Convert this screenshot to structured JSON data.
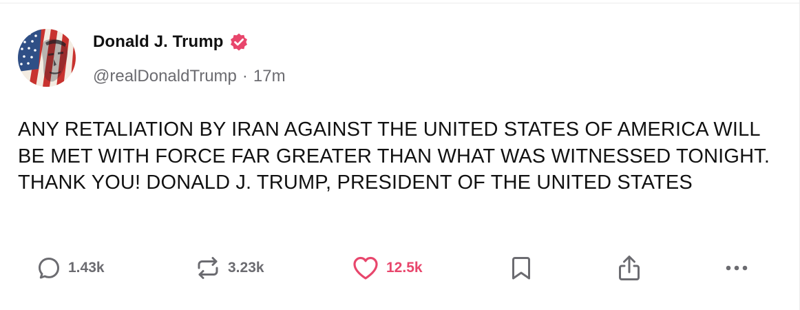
{
  "post": {
    "author": {
      "display_name": "Donald J. Trump",
      "handle": "@realDonaldTrump",
      "verified": true,
      "avatar_icon": "flag-portrait-avatar"
    },
    "separator": "·",
    "time_ago": "17m",
    "text": "ANY RETALIATION BY IRAN AGAINST THE UNITED STATES OF AMERICA WILL BE MET WITH FORCE FAR GREATER THAN WHAT WAS WITNESSED TONIGHT. THANK YOU! DONALD J. TRUMP, PRESIDENT OF THE UNITED STATES"
  },
  "actions": {
    "replies": {
      "icon": "reply-bubble-icon",
      "count": "1.43k"
    },
    "reposts": {
      "icon": "repost-icon",
      "count": "3.23k"
    },
    "likes": {
      "icon": "heart-icon",
      "count": "12.5k",
      "liked": true
    },
    "bookmark": {
      "icon": "bookmark-icon"
    },
    "share": {
      "icon": "share-icon"
    },
    "more": {
      "icon": "more-horizontal-icon"
    }
  },
  "colors": {
    "accent": "#e8466c",
    "muted_text": "#6b6b70",
    "text": "#111111",
    "verified_badge": "#e8466c"
  }
}
